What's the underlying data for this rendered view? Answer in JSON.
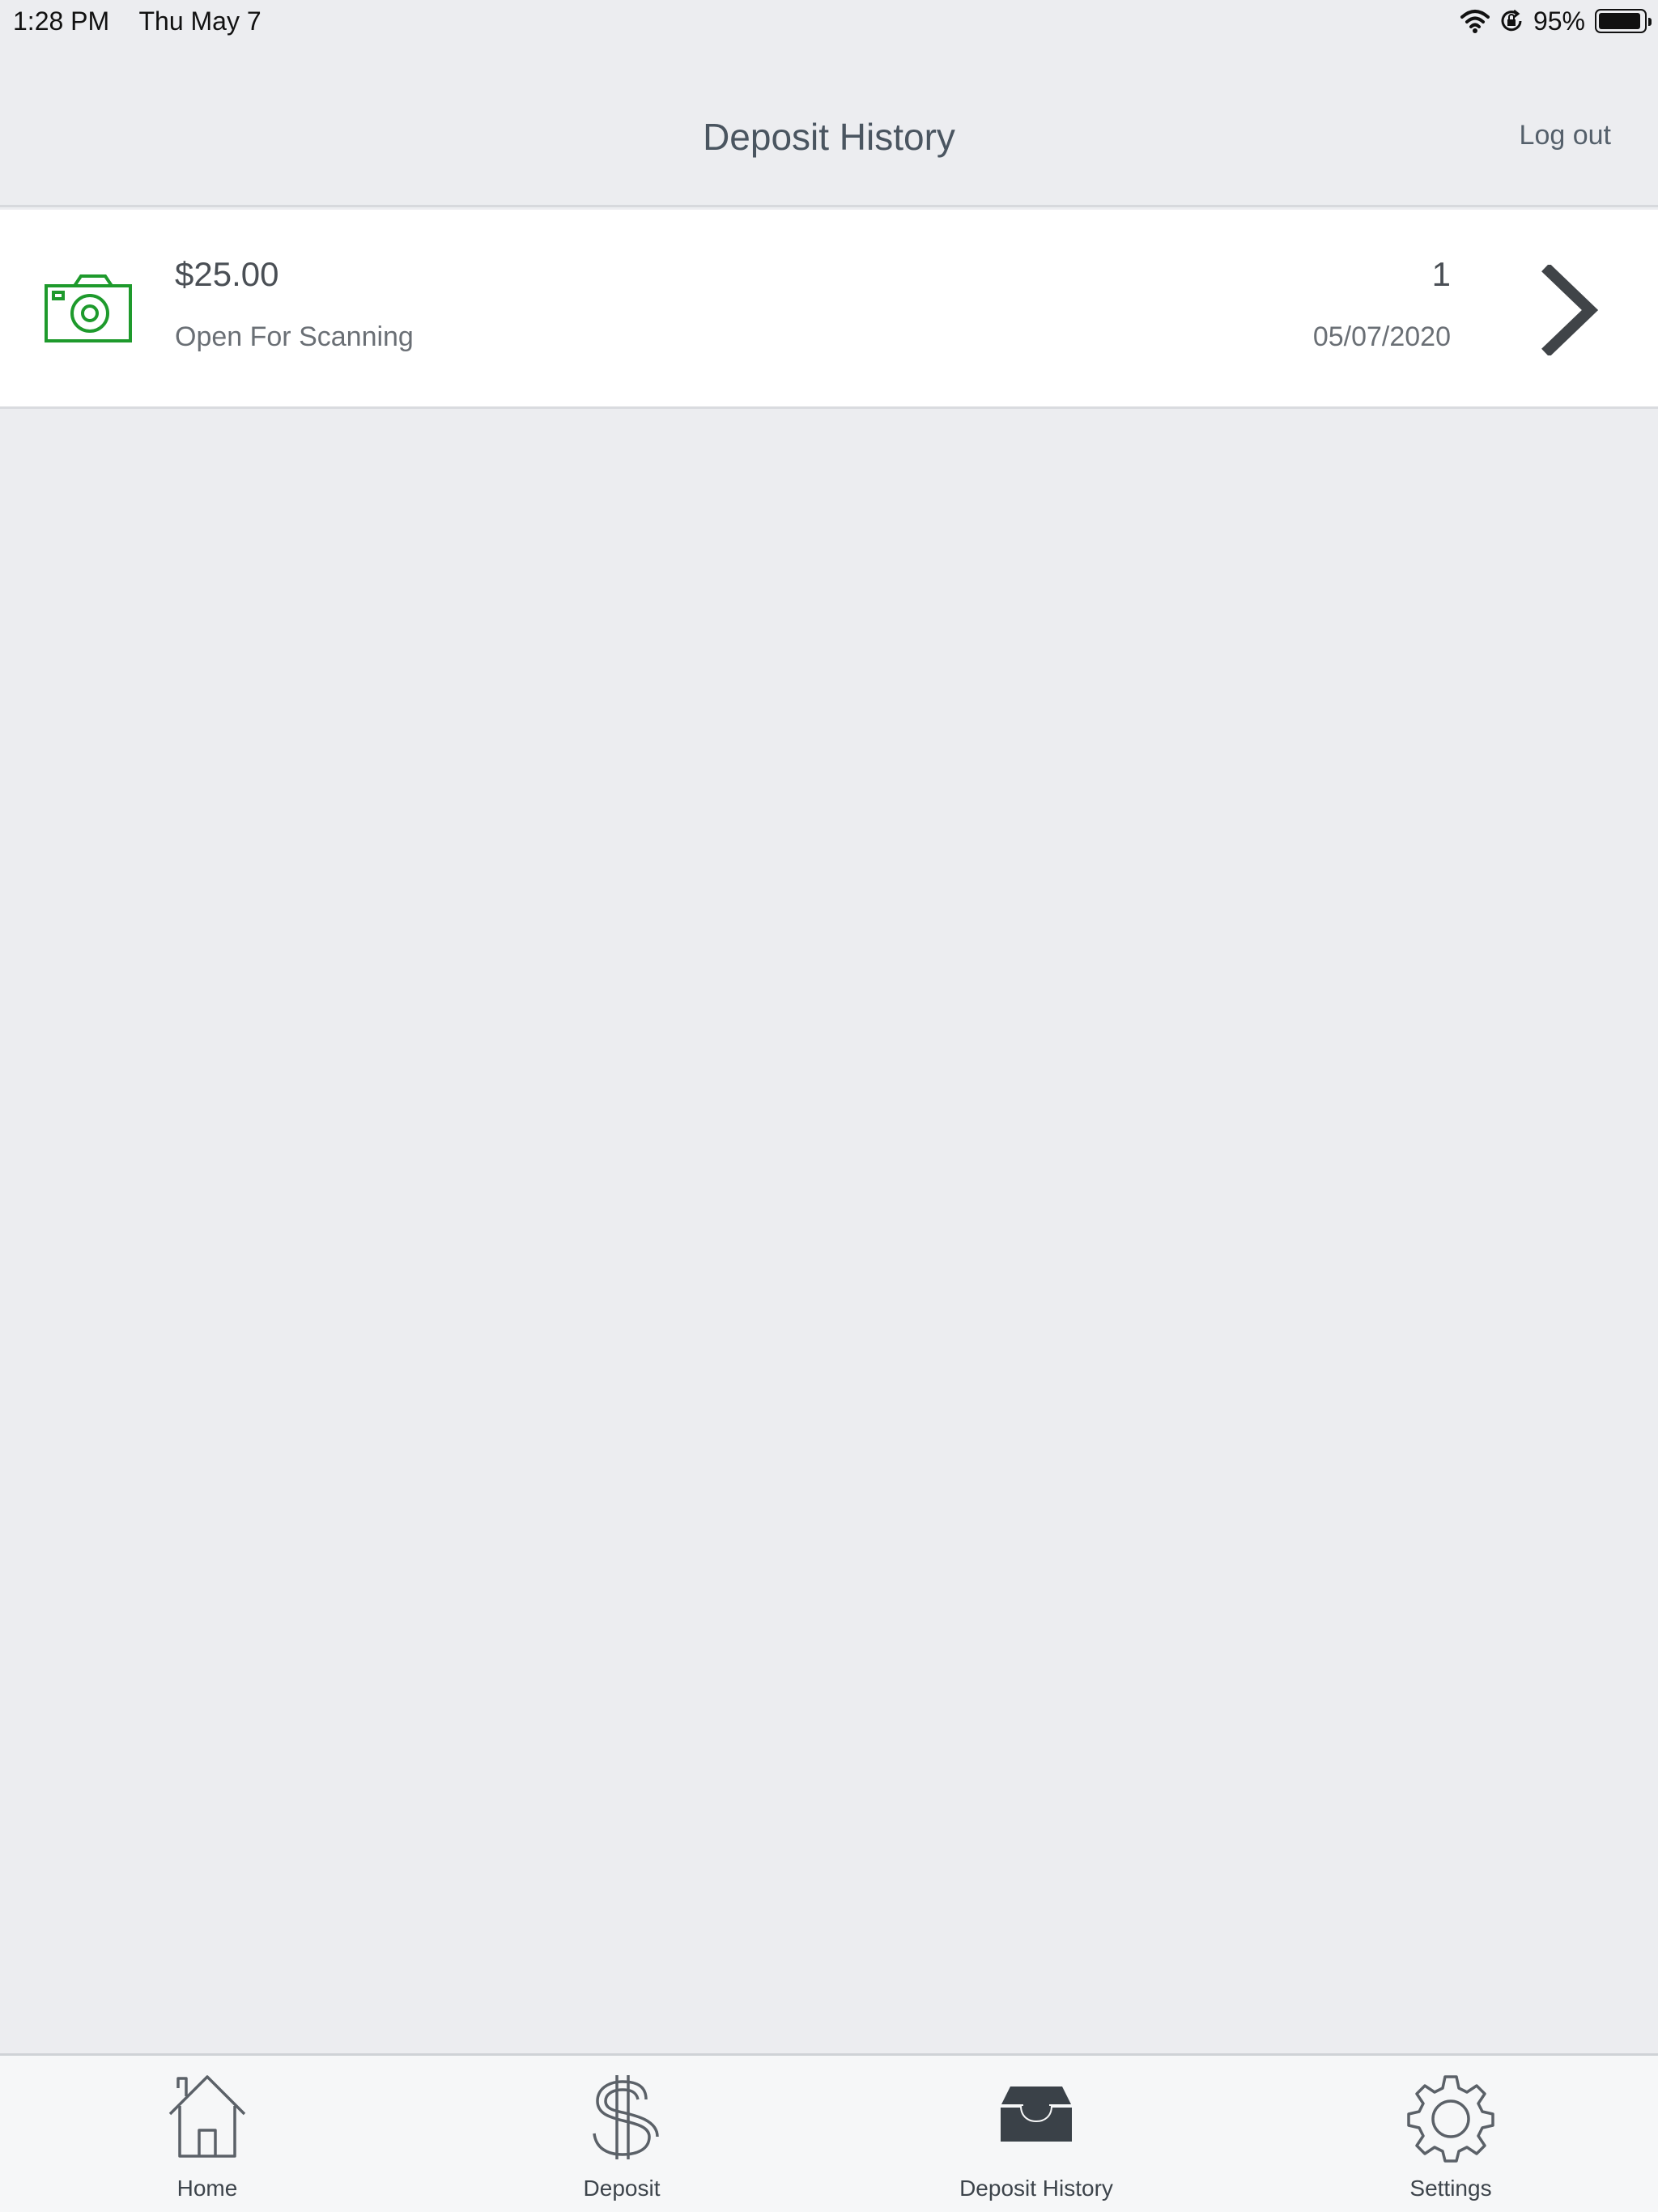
{
  "status_bar": {
    "time": "1:28 PM",
    "date": "Thu May 7",
    "battery": "95%",
    "battery_level": 0.95
  },
  "header": {
    "title": "Deposit History",
    "logout_label": "Log out"
  },
  "deposits": [
    {
      "amount": "$25.00",
      "status": "Open For Scanning",
      "count": "1",
      "date": "05/07/2020",
      "icon": "camera-icon",
      "icon_color": "#1e9a2c"
    }
  ],
  "tabs": [
    {
      "label": "Home",
      "icon": "home-icon"
    },
    {
      "label": "Deposit",
      "icon": "dollar-icon"
    },
    {
      "label": "Deposit History",
      "icon": "inbox-icon",
      "active": true
    },
    {
      "label": "Settings",
      "icon": "gear-icon"
    }
  ]
}
